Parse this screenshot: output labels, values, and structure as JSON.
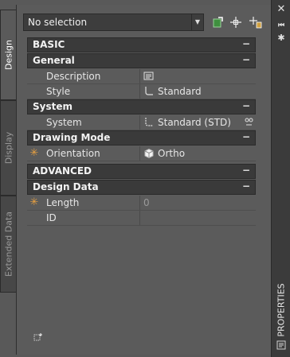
{
  "tabs": [
    {
      "label": "Design",
      "active": true
    },
    {
      "label": "Display",
      "active": false
    },
    {
      "label": "Extended Data",
      "active": false
    }
  ],
  "palette_title": "PROPERTIES",
  "selection": {
    "value": "No selection"
  },
  "sections": {
    "basic": {
      "label": "BASIC",
      "toggle": "−"
    },
    "general": {
      "label": "General",
      "toggle": "−"
    },
    "system_cat": {
      "label": "System",
      "toggle": "−"
    },
    "drawing_mode": {
      "label": "Drawing Mode",
      "toggle": "−"
    },
    "advanced": {
      "label": "ADVANCED",
      "toggle": "−"
    },
    "design_data": {
      "label": "Design Data",
      "toggle": "−"
    }
  },
  "props": {
    "description": {
      "name": "Description",
      "value": ""
    },
    "style": {
      "name": "Style",
      "value": "Standard"
    },
    "system": {
      "name": "System",
      "value": "Standard (STD)"
    },
    "orientation": {
      "name": "Orientation",
      "value": "Ortho"
    },
    "length": {
      "name": "Length",
      "value": "0"
    },
    "id": {
      "name": "ID",
      "value": ""
    }
  },
  "colors": {
    "accent": "#e8a040",
    "panel": "#5b5b5b",
    "header": "#3a3a3a"
  }
}
